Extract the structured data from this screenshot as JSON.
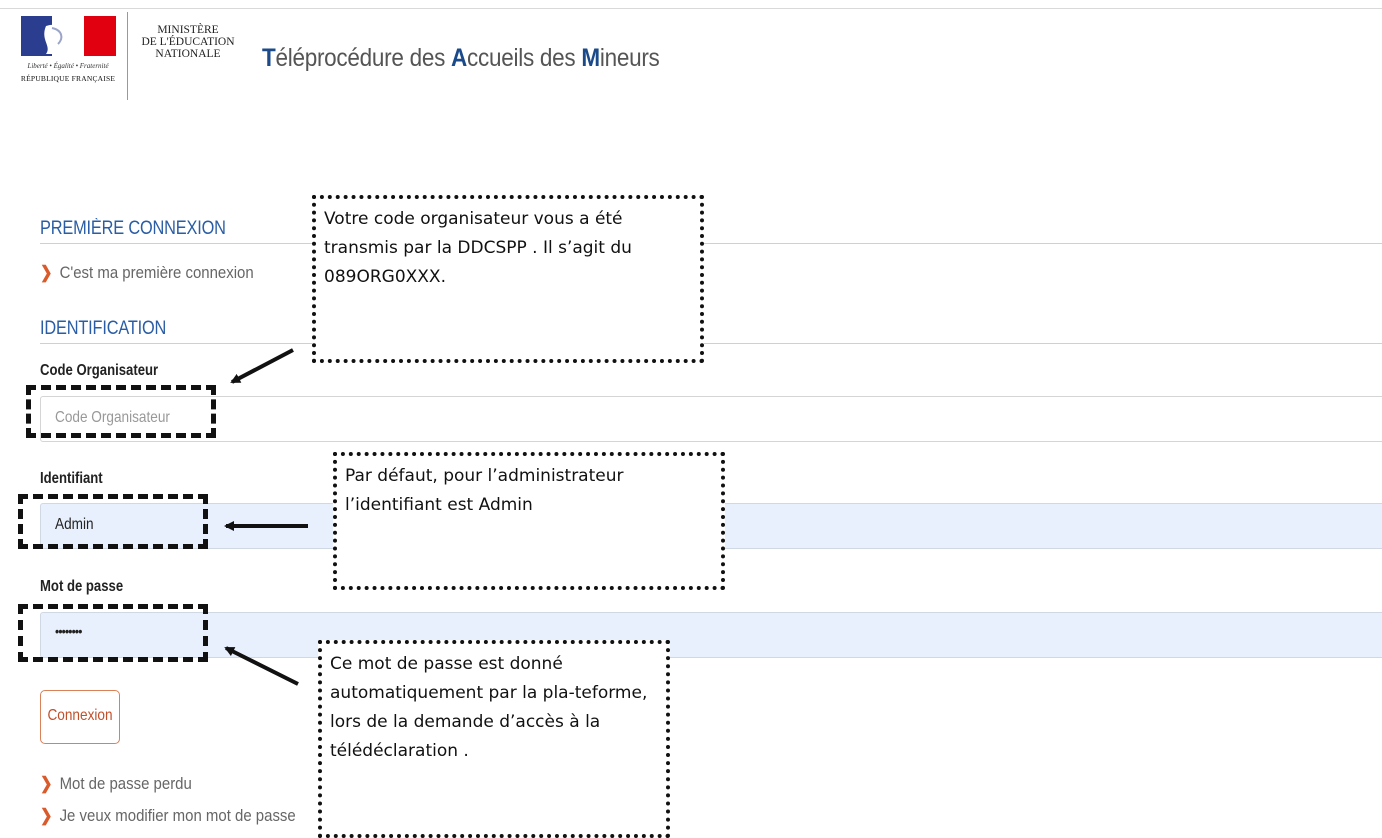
{
  "header": {
    "republique_motto": "Liberté • Égalité • Fraternité",
    "republique_name": "RÉPUBLIQUE FRANÇAISE",
    "ministere_lines": [
      "MINISTÈRE",
      "DE L'ÉDUCATION",
      "NATIONALE"
    ],
    "title": "Téléprocédure des Accueils des Mineurs"
  },
  "first_connection": {
    "heading": "PREMIÈRE CONNEXION",
    "link_label": "C'est ma première connexion"
  },
  "identification": {
    "heading": "IDENTIFICATION",
    "code_label": "Code Organisateur",
    "code_placeholder": "Code Organisateur",
    "login_label": "Identifiant",
    "login_value": "Admin",
    "password_label": "Mot de passe",
    "password_value": "••••••••",
    "submit_label": "Connexion",
    "lost_password_link": "Mot de passe perdu",
    "change_password_link": "Je veux modifier mon mot de passe"
  },
  "annotations": {
    "code_note": "Votre code organisateur vous a été transmis par la DDCSPP . Il s’agit du 089ORG0XXX.",
    "login_note": "Par défaut, pour l’administrateur l’identifiant est Admin",
    "password_note": "Ce mot de passe est donné automatiquement par la pla-teforme, lors de la demande d’accès à la télédéclaration ."
  },
  "colors": {
    "accent_blue": "#2a5da5",
    "title_highlight": "#1a4a8a",
    "chevron_orange": "#d95a2b",
    "filled_field_bg": "#e8f0fe"
  }
}
